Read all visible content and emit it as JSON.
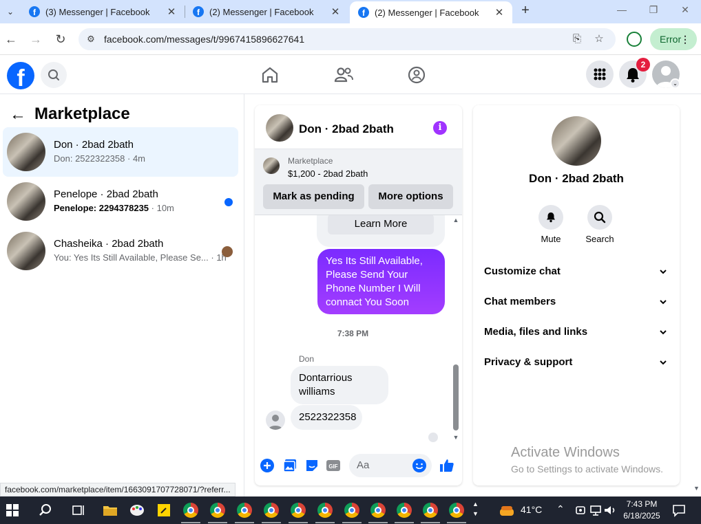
{
  "browser": {
    "tabs": [
      {
        "title": "(3) Messenger | Facebook",
        "active": false
      },
      {
        "title": "(2) Messenger | Facebook",
        "active": false
      },
      {
        "title": "(2) Messenger | Facebook",
        "active": true
      }
    ],
    "url": "facebook.com/messages/t/9967415896627641",
    "profile_status": "Error",
    "status_url": "facebook.com/marketplace/item/1663091707728071/?referr..."
  },
  "header": {
    "notification_count": "2"
  },
  "sidebar": {
    "title": "Marketplace",
    "conversations": [
      {
        "name": "Don · 2bad 2bath",
        "snippet": "Don: 2522322358",
        "time": "· 4m",
        "unread": false,
        "selected": true
      },
      {
        "name": "Penelope · 2bad 2bath",
        "snippet": "Penelope: 2294378235",
        "time": " · 10m",
        "unread": true,
        "selected": false
      },
      {
        "name": "Chasheika · 2bad 2bath",
        "snippet": "You: Yes Its Still Available, Please Se...",
        "time": " · 1h",
        "unread": false,
        "selected": false
      }
    ]
  },
  "chat": {
    "name": "Don · 2bad 2bath",
    "listing": {
      "label": "Marketplace",
      "price_title": "$1,200 - 2bad 2bath",
      "mark_pending": "Mark as pending",
      "more_options": "More options"
    },
    "learn_more": "Learn More",
    "outgoing_message": "Yes Its Still Available, Please Send Your Phone Number I Will connact You Soon",
    "timestamp": "7:38 PM",
    "sender": "Don",
    "incoming_messages": [
      "Dontarrious williams",
      "2522322358"
    ],
    "composer_placeholder": "Aa"
  },
  "info_panel": {
    "name": "Don · 2bad 2bath",
    "actions": [
      {
        "label": "Mute"
      },
      {
        "label": "Search"
      }
    ],
    "sections": [
      "Customize chat",
      "Chat members",
      "Media, files and links",
      "Privacy & support"
    ]
  },
  "watermark": {
    "line1": "Activate Windows",
    "line2": "Go to Settings to activate Windows."
  },
  "taskbar": {
    "temperature": "41°C",
    "time": "7:43 PM",
    "date": "6/18/2025"
  },
  "colors": {
    "fb_blue": "#0866ff",
    "purple_accent": "#a033ff",
    "unread_dot": "#0866ff"
  }
}
